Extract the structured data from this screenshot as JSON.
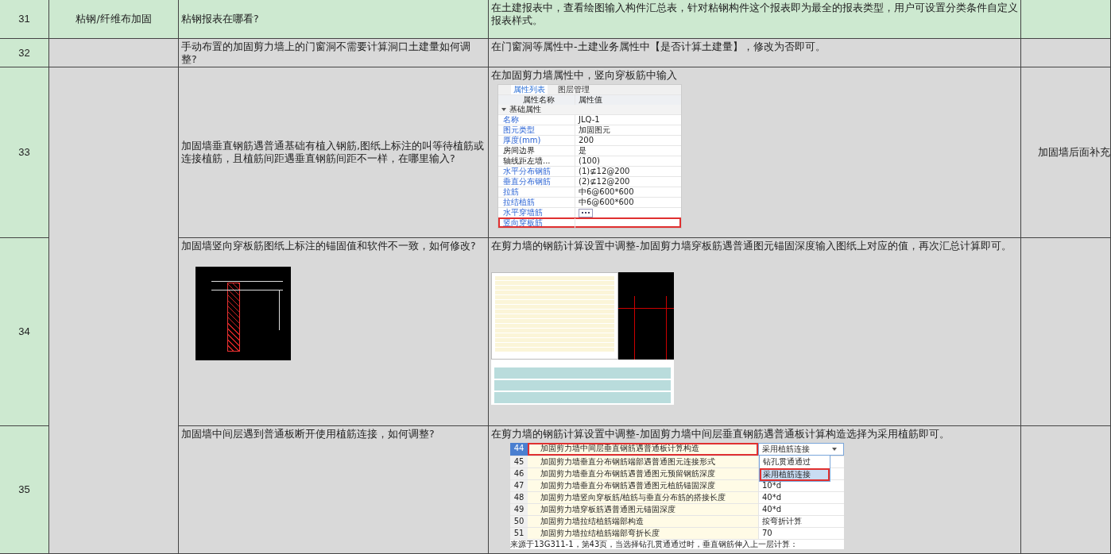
{
  "rows": [
    {
      "number": "31",
      "category": "粘钢/纤维布加固",
      "question": "粘钢报表在哪看?",
      "answer": "在土建报表中，查看绘图输入构件汇总表，针对粘钢构件这个报表即为最全的报表类型，用户可设置分类条件自定义报表样式。",
      "highlighted": true
    },
    {
      "number": "32",
      "question": "手动布置的加固剪力墙上的门窗洞不需要计算洞口土建量如何调整?",
      "answer": "在门窗洞等属性中-土建业务属性中【是否计算土建量】，修改为否即可。",
      "highlighted": false
    },
    {
      "number": "33",
      "question": "加固墙垂直钢筋遇普通基础有植入钢筋,图纸上标注的叫等待植筋或连接植筋，且植筋间距遇垂直钢筋间距不一样，在哪里输入?",
      "answer": "在加固剪力墙属性中，竖向穿板筋中输入",
      "note": "加固墙后面补充",
      "highlighted": false,
      "attachment": {
        "kind": "property-panel",
        "tabs": [
          {
            "label": "属性列表",
            "selected": true
          },
          {
            "label": "图层管理",
            "selected": false
          }
        ],
        "columns": [
          "属性名称",
          "属性值"
        ],
        "group": "基础属性",
        "properties": [
          {
            "name": "名称",
            "value": "JLQ-1",
            "emphasized": true,
            "marked": false
          },
          {
            "name": "图元类型",
            "value": "加固图元",
            "emphasized": true,
            "marked": false
          },
          {
            "name": "厚度(mm)",
            "value": "200",
            "emphasized": true,
            "marked": false
          },
          {
            "name": "房间边界",
            "value": "是",
            "emphasized": false,
            "marked": false
          },
          {
            "name": "轴线距左墙...",
            "value": "(100)",
            "emphasized": false,
            "marked": false
          },
          {
            "name": "水平分布钢筋",
            "value": "(1)⊈12@200",
            "emphasized": true,
            "marked": false
          },
          {
            "name": "垂直分布钢筋",
            "value": "(2)⊈12@200",
            "emphasized": true,
            "marked": false
          },
          {
            "name": "拉筋",
            "value": "中6@600*600",
            "emphasized": true,
            "marked": false
          },
          {
            "name": "拉结植筋",
            "value": "中6@600*600",
            "emphasized": true,
            "marked": false
          },
          {
            "name": "水平穿墙筋",
            "emphasized": true,
            "marked": false,
            "kind": "picker"
          },
          {
            "name": "竖向穿板筋",
            "emphasized": true,
            "marked": true
          }
        ]
      }
    },
    {
      "number": "34",
      "question": "加固墙竖向穿板筋图纸上标注的锚固值和软件不一致，如何修改?",
      "answer": "在剪力墙的钢筋计算设置中调整-加固剪力墙穿板筋遇普通图元锚固深度输入图纸上对应的值，再次汇总计算即可。",
      "highlighted": false,
      "attachment": {
        "kind": "drawings"
      }
    },
    {
      "number": "35",
      "question": "加固墙中间层遇到普通板断开使用植筋连接，如何调整?",
      "answer": "在剪力墙的钢筋计算设置中调整-加固剪力墙中间层垂直钢筋遇普通板计算构造选择为采用植筋即可。",
      "highlighted": false,
      "attachment": {
        "kind": "settings-table",
        "settings": [
          {
            "number": "44",
            "name": "加固剪力墙中间层垂直钢筋遇普通板计算构造",
            "value": "采用植筋连接",
            "selected": true
          },
          {
            "number": "45",
            "name": "加固剪力墙垂直分布钢筋端部遇普通图元连接形式",
            "selected": false
          },
          {
            "number": "46",
            "name": "加固剪力墙垂直分布钢筋遇普通图元预留钢筋深度",
            "selected": false
          },
          {
            "number": "47",
            "name": "加固剪力墙垂直分布钢筋遇普通图元植筋锚固深度",
            "value": "10*d",
            "selected": false
          },
          {
            "number": "48",
            "name": "加固剪力墙竖向穿板筋/植筋与垂直分布筋的搭接长度",
            "value": "40*d",
            "selected": false
          },
          {
            "number": "49",
            "name": "加固剪力墙穿板筋遇普通图元锚固深度",
            "value": "40*d",
            "selected": false
          },
          {
            "number": "50",
            "name": "加固剪力墙拉结植筋端部构造",
            "value": "按弯折计算",
            "selected": false
          },
          {
            "number": "51",
            "name": "加固剪力墙拉结植筋端部弯折长度",
            "value": "70",
            "selected": false
          }
        ],
        "dropdown_options": [
          {
            "label": "钻孔贯通通过",
            "selected": false
          },
          {
            "label": "采用植筋连接",
            "selected": true
          }
        ],
        "caption": "来源于13G311-1，第43页，当选择钻孔贯通通过时，垂直钢筋伸入上一层计算："
      }
    }
  ]
}
